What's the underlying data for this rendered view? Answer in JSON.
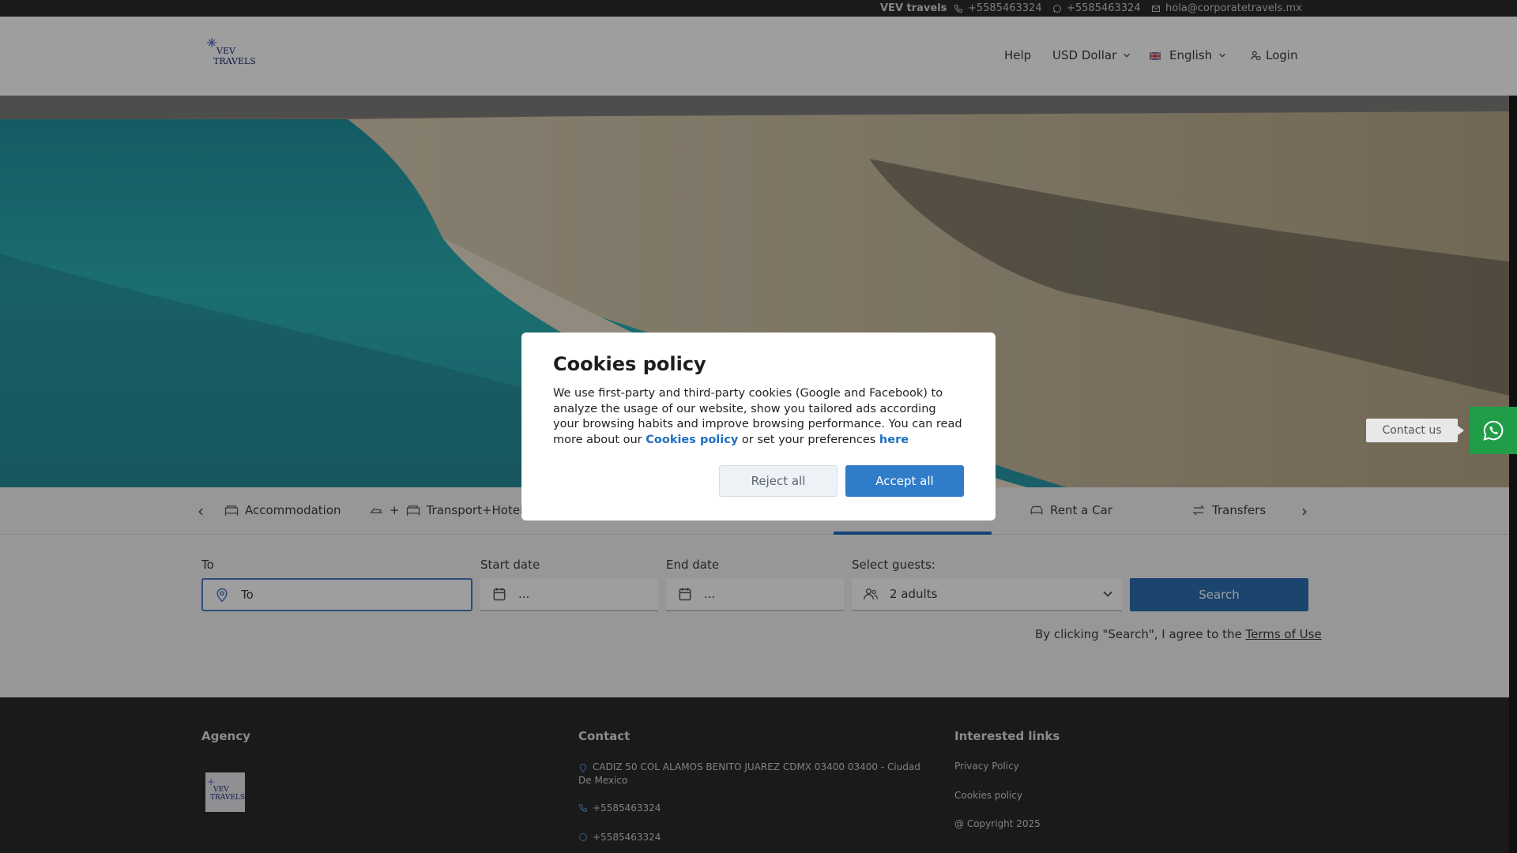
{
  "topbar": {
    "brand": "VEV travels",
    "phone": "+5585463324",
    "whatsapp": "+5585463324",
    "email": "hola@corporatetravels.mx"
  },
  "header": {
    "logo_text_line1": "VEV",
    "logo_text_line2": "TRAVELS",
    "help": "Help",
    "currency": "USD Dollar",
    "language": "English",
    "login": "Login"
  },
  "tabs": {
    "items": [
      {
        "label": "Accommodation",
        "icon": "bed-icon"
      },
      {
        "label": "+",
        "icon": "plane-icon"
      },
      {
        "label": "Transport+Hotel",
        "icon": "bed-icon"
      },
      {
        "label": "Rent a Car",
        "icon": "car-icon"
      },
      {
        "label": "Transfers",
        "icon": "transfer-icon"
      }
    ]
  },
  "form": {
    "to_label": "To",
    "to_placeholder": "To",
    "start_label": "Start date",
    "start_value": "...",
    "end_label": "End date",
    "end_value": "...",
    "guests_label": "Select guests:",
    "guests_value": "2 adults",
    "search_button": "Search",
    "terms_text": "By clicking \"Search\", I agree to the",
    "terms_link": "Terms of Use"
  },
  "footer": {
    "agency_heading": "Agency",
    "contact_heading": "Contact",
    "address": "CADIZ 50 COL ALAMOS BENITO JUAREZ CDMX 03400 03400 - Ciudad De Mexico",
    "phone": "+5585463324",
    "whatsapp": "+5585463324",
    "links_heading": "Interested links",
    "privacy": "Privacy Policy",
    "cookies": "Cookies policy",
    "copyright": "@ Copyright 2025"
  },
  "contact_widget": {
    "label": "Contact us",
    "color": "#1f9d47"
  },
  "cookie_modal": {
    "title": "Cookies policy",
    "body": "We use first-party and third-party cookies (Google and Facebook) to analyze the usage of our website, show you tailored ads according your browsing habits and improve browsing performance. You can read more about our",
    "policy_link": "Cookies policy",
    "middle": "or set your preferences",
    "here_link": "here",
    "reject": "Reject all",
    "accept": "Accept all"
  },
  "colors": {
    "accent": "#2f7cc8",
    "topbar": "#2b2b2b",
    "footer": "#2b2b2b"
  }
}
